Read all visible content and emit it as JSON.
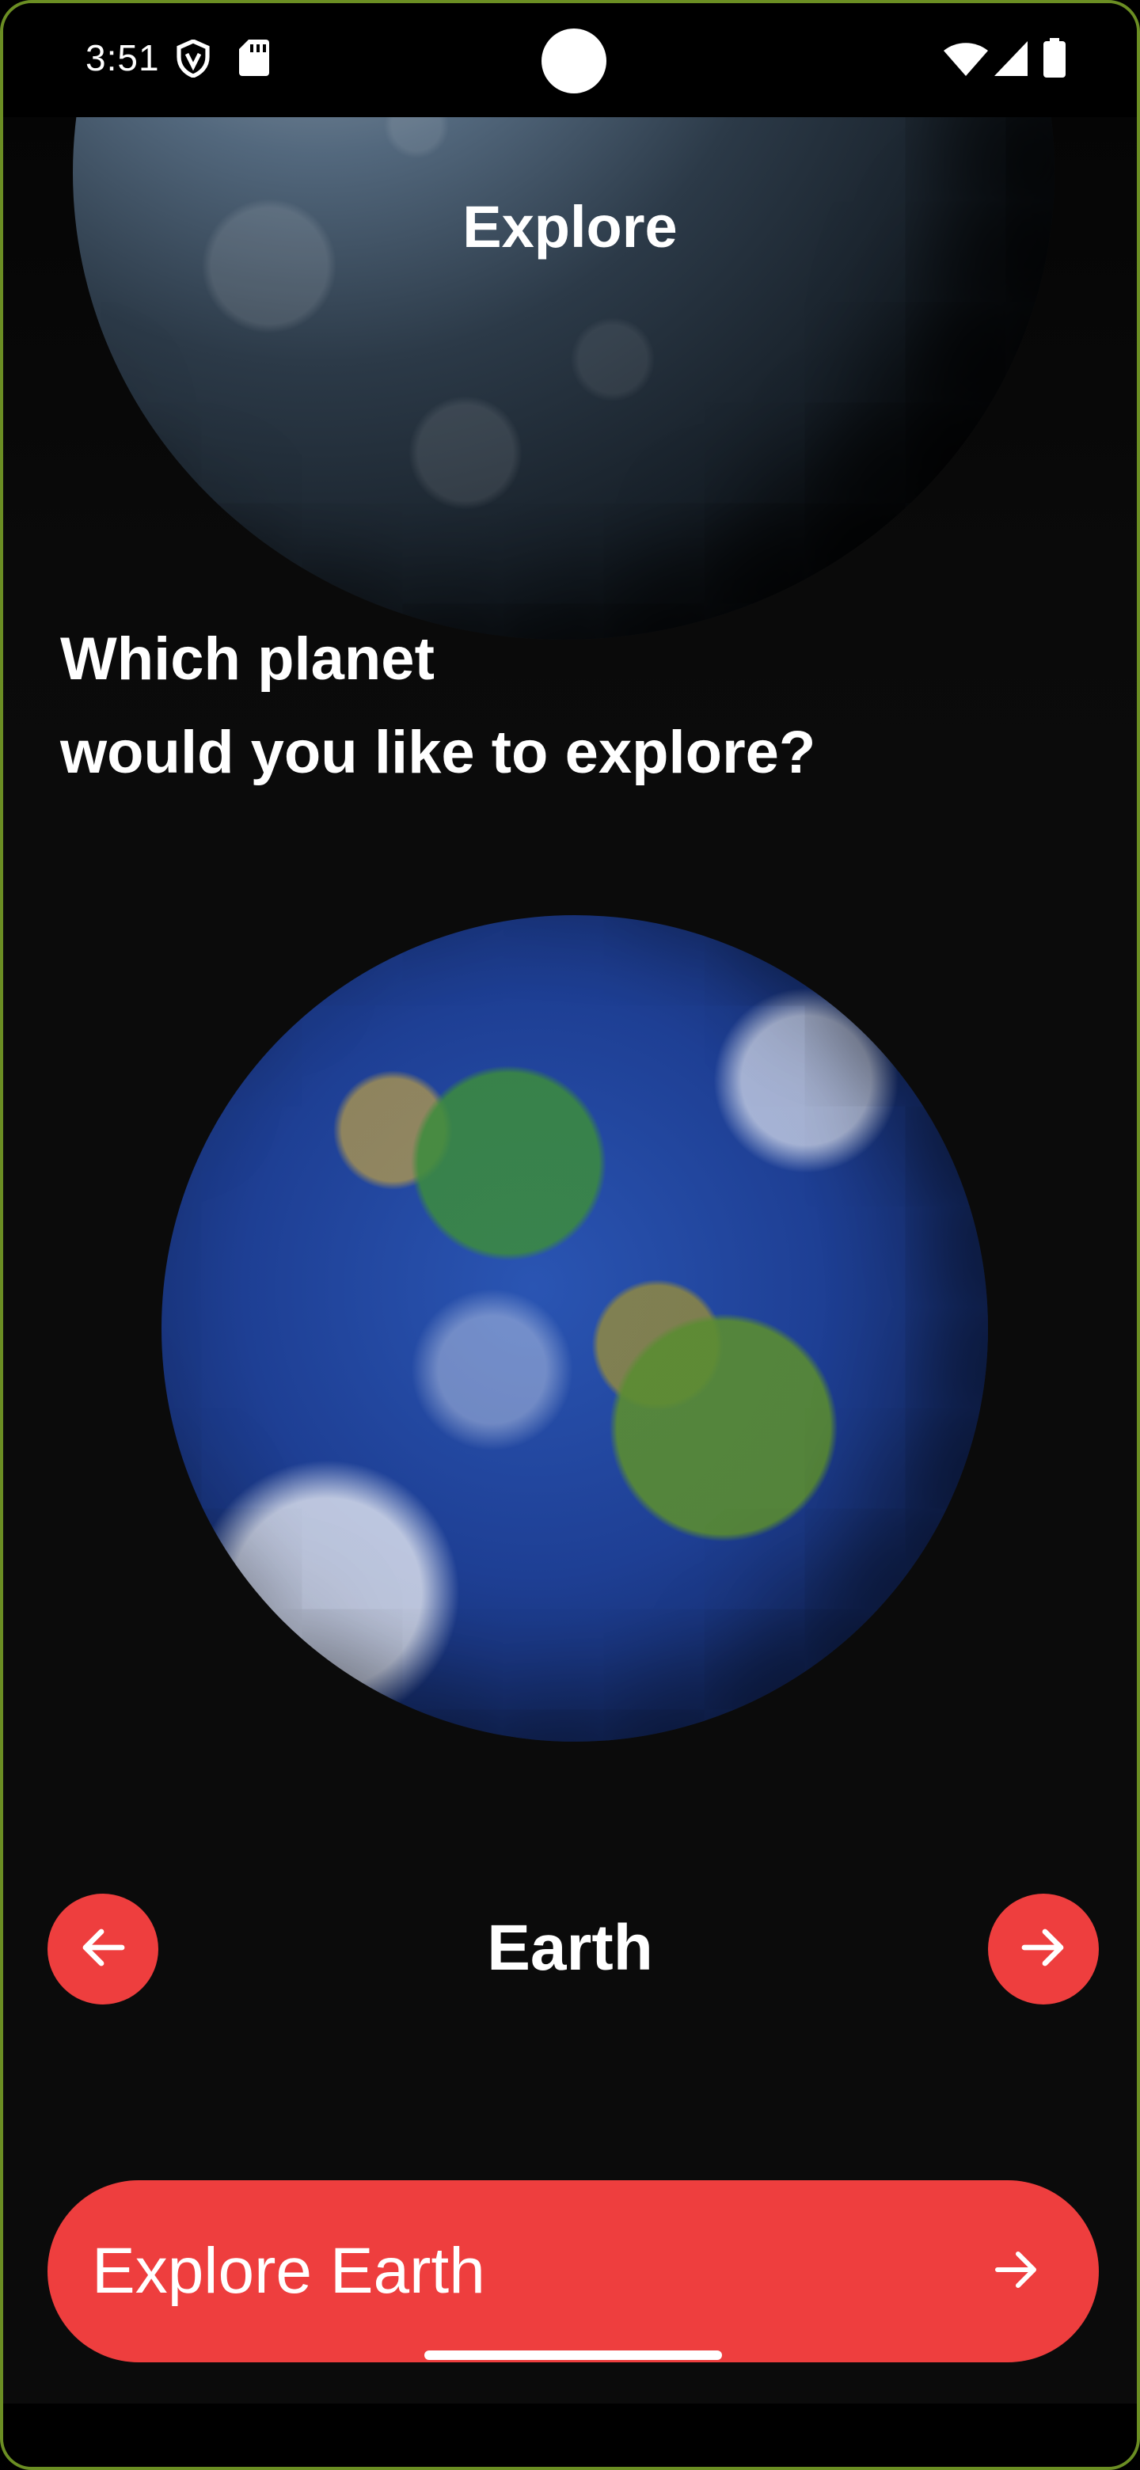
{
  "status_bar": {
    "time": "3:51",
    "icons": [
      "shield-icon",
      "sd-card-icon",
      "wifi-icon",
      "signal-icon",
      "battery-icon"
    ]
  },
  "header": {
    "title": "Explore"
  },
  "prompt": {
    "line1": "Which planet",
    "line2": "would you like to explore?"
  },
  "selector": {
    "planet_name": "Earth",
    "prev_icon": "arrow-left-icon",
    "next_icon": "arrow-right-icon"
  },
  "cta": {
    "label": "Explore Earth",
    "icon": "arrow-right-icon"
  },
  "colors": {
    "accent": "#ee3e3e",
    "background": "#0b0b0b",
    "text": "#ffffff"
  }
}
